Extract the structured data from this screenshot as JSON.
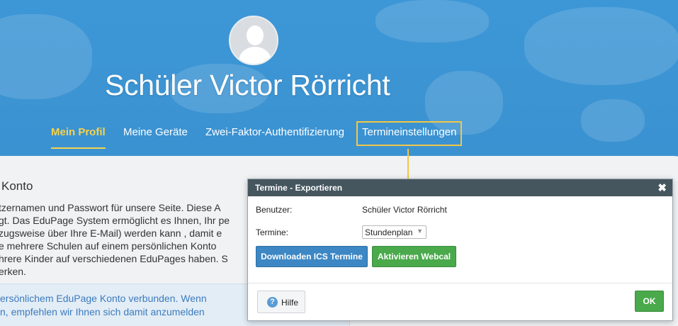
{
  "profile": {
    "name": "Schüler Victor Rörricht"
  },
  "tabs": [
    {
      "label": "Mein Profil",
      "active": true
    },
    {
      "label": "Meine Geräte",
      "active": false
    },
    {
      "label": "Zwei-Faktor-Authentifizierung",
      "active": false
    },
    {
      "label": "Termineinstellungen",
      "active": false
    }
  ],
  "card": {
    "title": "Konto",
    "lines": [
      "tzernamen und Passwort für unsere Seite. Diese A",
      "gt. Das EduPage System ermöglicht es Ihnen, Ihr pe",
      "zugsweise über Ihre E-Mail) werden kann , damit e",
      "e mehrere Schulen auf einem persönlichen Konto",
      "hrere Kinder auf verschiedenen EduPages haben. S",
      "erken."
    ],
    "info_lines": [
      "ersönlichem EduPage Konto verbunden. Wenn",
      "n, empfehlen wir Ihnen sich damit anzumelden"
    ]
  },
  "dialog": {
    "title": "Termine - Exportieren",
    "close_icon": "close-icon",
    "user_label": "Benutzer:",
    "user_value": "Schüler Victor Rörricht",
    "termine_label": "Termine:",
    "termine_selected": "Stundenplan",
    "download_button": "Downloaden ICS Termine",
    "webcal_button": "Aktivieren Webcal",
    "help_button": "Hilfe",
    "ok_button": "OK"
  },
  "colors": {
    "header_bg": "#3b92d1",
    "active_tab": "#f5d34d",
    "highlight": "#f2c744",
    "dialog_header": "#45565f",
    "button_blue": "#3c87c4",
    "button_green": "#49a94b"
  }
}
